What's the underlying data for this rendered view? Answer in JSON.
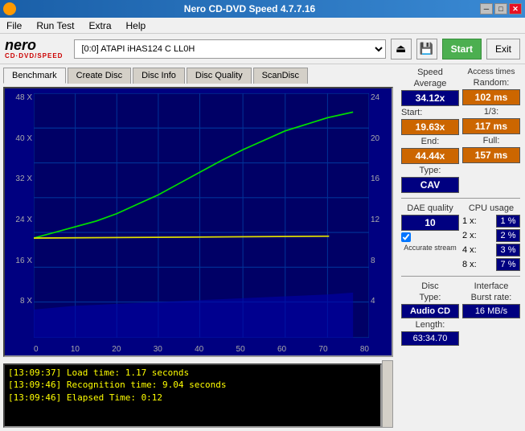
{
  "window": {
    "title": "Nero CD-DVD Speed 4.7.7.16",
    "minimize": "─",
    "maximize": "□",
    "close": "✕"
  },
  "menu": {
    "items": [
      "File",
      "Run Test",
      "Extra",
      "Help"
    ]
  },
  "toolbar": {
    "logo_nero": "nero",
    "logo_sub": "CD·DVD/SPEED",
    "drive": "[0:0]  ATAPI iHAS124  C LL0H",
    "start_label": "Start",
    "exit_label": "Exit"
  },
  "tabs": [
    "Benchmark",
    "Create Disc",
    "Disc Info",
    "Disc Quality",
    "ScanDisc"
  ],
  "active_tab": "Benchmark",
  "chart": {
    "y_left_labels": [
      "48 X",
      "40 X",
      "32 X",
      "24 X",
      "16 X",
      "8 X",
      ""
    ],
    "y_right_labels": [
      "24",
      "20",
      "16",
      "12",
      "8",
      "4",
      ""
    ],
    "x_labels": [
      "0",
      "10",
      "20",
      "30",
      "40",
      "50",
      "60",
      "70",
      "80"
    ]
  },
  "log": {
    "entries": [
      "[13:09:37]  Load time: 1.17 seconds",
      "[13:09:46]  Recognition time: 9.04 seconds",
      "[13:09:46]  Elapsed Time: 0:12"
    ]
  },
  "stats": {
    "speed": {
      "label": "Speed",
      "average_label": "Average",
      "average_value": "34.12x",
      "start_label": "Start:",
      "start_value": "19.63x",
      "end_label": "End:",
      "end_value": "44.44x",
      "type_label": "Type:",
      "type_value": "CAV"
    },
    "access": {
      "label": "Access times",
      "random_label": "Random:",
      "random_value": "102 ms",
      "one_third_label": "1/3:",
      "one_third_value": "117 ms",
      "full_label": "Full:",
      "full_value": "157 ms"
    },
    "cpu": {
      "label": "CPU usage",
      "rows": [
        {
          "label": "1 x:",
          "value": "1 %"
        },
        {
          "label": "2 x:",
          "value": "2 %"
        },
        {
          "label": "4 x:",
          "value": "3 %"
        },
        {
          "label": "8 x:",
          "value": "7 %"
        }
      ]
    },
    "dae": {
      "label": "DAE quality",
      "value": "10"
    },
    "accurate_stream": {
      "label": "Accurate stream",
      "checked": true
    },
    "disc": {
      "label": "Disc",
      "type_label": "Type:",
      "type_value": "Audio CD",
      "length_label": "Length:",
      "length_value": "63:34.70"
    },
    "interface": {
      "label": "Interface",
      "burst_label": "Burst rate:",
      "burst_value": "16 MB/s"
    }
  }
}
